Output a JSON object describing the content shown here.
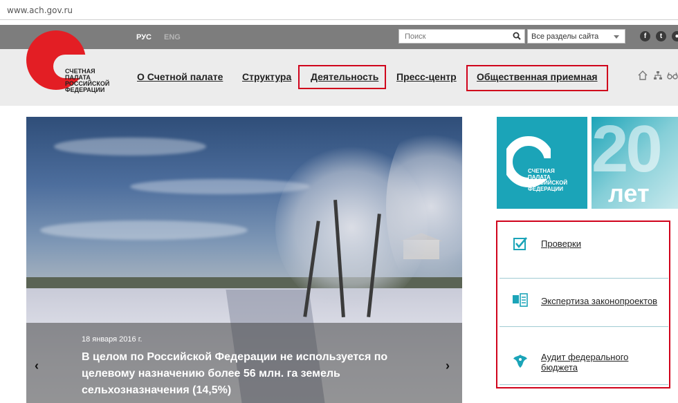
{
  "browser": {
    "url": "www.ach.gov.ru"
  },
  "header": {
    "lang_ru": "РУС",
    "lang_en": "ENG",
    "search_placeholder": "Поиск",
    "section_select": "Все разделы сайта",
    "social": [
      "f",
      "t",
      "●"
    ]
  },
  "logo": {
    "lines": [
      "СЧЕТНАЯ",
      "ПАЛАТА",
      "РОССИЙСКОЙ",
      "ФЕДЕРАЦИИ"
    ],
    "color": "#e31e24"
  },
  "nav": {
    "items": [
      {
        "label": "О Счетной палате"
      },
      {
        "label": "Структура"
      },
      {
        "label": "Деятельность"
      },
      {
        "label": "Пресс-центр"
      },
      {
        "label": "Общественная приемная"
      }
    ]
  },
  "hero": {
    "date": "18 января 2016 г.",
    "title": "В целом по Российской Федерации не используется по целевому назначению более 56 млн. га земель сельхозназначения (14,5%)",
    "prev": "‹",
    "next": "›"
  },
  "anniversary": {
    "lines": [
      "СЧЕТНАЯ",
      "ПАЛАТА",
      "РОССИЙСКОЙ",
      "ФЕДЕРАЦИИ"
    ],
    "number": "20",
    "suffix": "лет"
  },
  "side_links": [
    {
      "label": "Проверки",
      "icon": "checkbox-icon"
    },
    {
      "label": "Экспертиза законопроектов",
      "icon": "documents-icon"
    },
    {
      "label": "Аудит федерального бюджета",
      "icon": "eagle-icon"
    }
  ],
  "colors": {
    "accent_red": "#d0021b",
    "teal": "#1ba4b8"
  }
}
